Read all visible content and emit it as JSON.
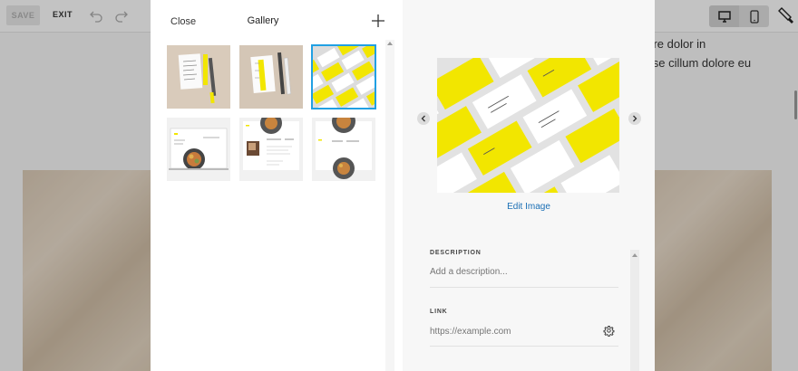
{
  "editor": {
    "save_label": "SAVE",
    "exit_label": "EXIT",
    "body_text_line1": "irure dolor in",
    "body_text_line2": "esse cillum dolore eu"
  },
  "gallery": {
    "close_label": "Close",
    "title": "Gallery",
    "selected_index": 2,
    "thumbnails": [
      {
        "icon": "menu-card-photo"
      },
      {
        "icon": "menu-card-yellow-photo"
      },
      {
        "icon": "business-cards-photo"
      },
      {
        "icon": "laptop-website-photo"
      },
      {
        "icon": "website-layout-photo"
      },
      {
        "icon": "website-food-photo"
      }
    ]
  },
  "details": {
    "edit_image_label": "Edit Image",
    "description": {
      "label": "DESCRIPTION",
      "placeholder": "Add a description..."
    },
    "link": {
      "label": "LINK",
      "placeholder": "https://example.com"
    }
  },
  "colors": {
    "accent_blue": "#21a0e3",
    "link_blue": "#1a6fb5",
    "brand_yellow": "#f2e600"
  }
}
